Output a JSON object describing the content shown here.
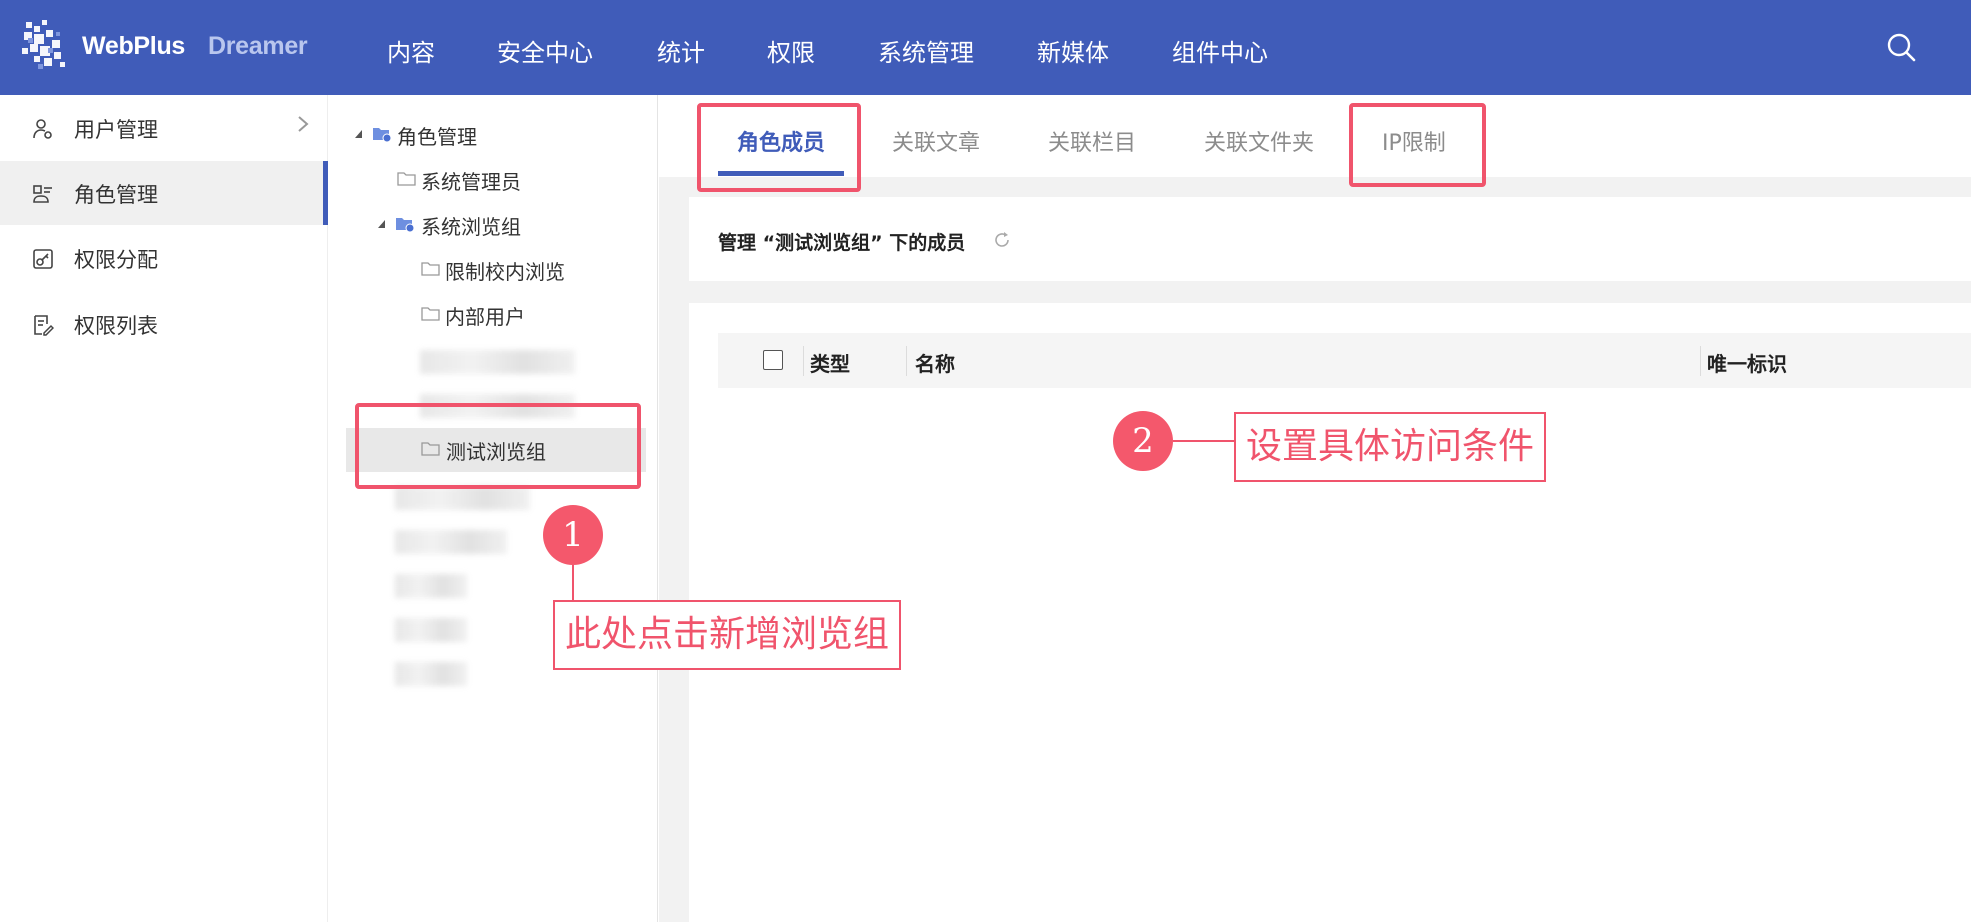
{
  "app": {
    "logo_text": "WebPlus",
    "logo_sub": "Dreamer"
  },
  "nav": {
    "items": [
      "内容",
      "安全中心",
      "统计",
      "权限",
      "系统管理",
      "新媒体",
      "组件中心"
    ]
  },
  "sidebar": {
    "items": [
      {
        "label": "用户管理",
        "icon": "user-gear-icon"
      },
      {
        "label": "角色管理",
        "icon": "role-icon"
      },
      {
        "label": "权限分配",
        "icon": "key-icon"
      },
      {
        "label": "权限列表",
        "icon": "list-edit-icon"
      }
    ]
  },
  "tree": {
    "root": "角色管理",
    "admin": "系统管理员",
    "browse_group": "系统浏览组",
    "child1": "限制校内浏览",
    "child2": "内部用户",
    "selected": "测试浏览组"
  },
  "tabs": [
    "角色成员",
    "关联文章",
    "关联栏目",
    "关联文件夹",
    "IP限制"
  ],
  "panel": {
    "title": "管理 “测试浏览组” 下的成员"
  },
  "table": {
    "columns": [
      "类型",
      "名称",
      "唯一标识"
    ]
  },
  "annotations": {
    "badge1": "1",
    "badge2": "2",
    "callout1": "此处点击新增浏览组",
    "callout2": "设置具体访问条件"
  },
  "colors": {
    "brand": "#405cb9",
    "accent": "#f0546c"
  }
}
